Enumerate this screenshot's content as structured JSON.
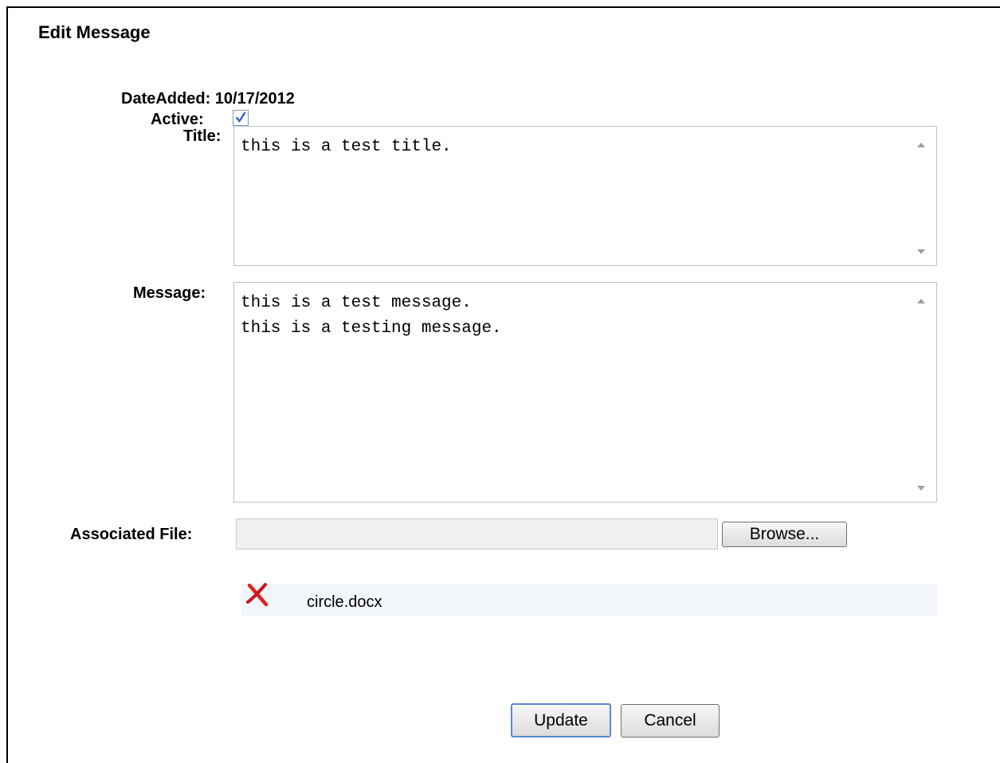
{
  "page": {
    "title": "Edit Message"
  },
  "form": {
    "date_added_label": "DateAdded:",
    "date_added_value": "10/17/2012",
    "active_label": "Active:",
    "active_checked": true,
    "title_label": "Title:",
    "title_value": "this is a test title.",
    "message_label": "Message:",
    "message_value": "this is a test message.\nthis is a testing message.",
    "file_label": "Associated File:",
    "file_value": "",
    "browse_label": "Browse..."
  },
  "attachment": {
    "file_name": "circle.docx",
    "delete_icon": "red-x-icon"
  },
  "actions": {
    "update_label": "Update",
    "cancel_label": "Cancel"
  },
  "colors": {
    "checkbox_check": "#3a5fcd",
    "delete_icon": "#e02020",
    "attachment_row_bg": "#f2f6fb"
  }
}
